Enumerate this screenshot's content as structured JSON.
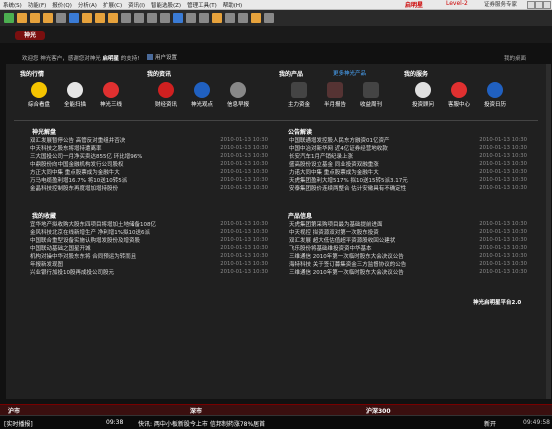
{
  "menu": {
    "items": [
      "系统(S)",
      "功能(F)",
      "报价(Q)",
      "分析(A)",
      "扩展(C)",
      "资讯(I)",
      "智能选股(Z)",
      "管理工具(T)",
      "帮助(H)"
    ],
    "brand": "启明星",
    "level": "Level-2",
    "right": "证券服务专家"
  },
  "toolbar": {
    "colors": [
      "#4caf50",
      "#e6a23c",
      "#e6a23c",
      "#e6a23c",
      "#888",
      "#3a7bd5",
      "#e6a23c",
      "#e6a23c",
      "#e6a23c",
      "#888",
      "#888",
      "#888",
      "#888",
      "#3a7bd5",
      "#888",
      "#888",
      "#e6a23c",
      "#888",
      "#888",
      "#e6a23c",
      "#888"
    ]
  },
  "header": {
    "logo_text": "神光",
    "welcome_prefix": "欢迎您",
    "welcome_text": "神光客户，感谢您对神光",
    "product": "启明星",
    "welcome_suffix": "的支持!",
    "user_settings": "用户设置",
    "my_desktop": "我的桌面"
  },
  "sections": {
    "market": {
      "title": "我的行情",
      "items": [
        "综合看盘",
        "全能扫描",
        "神光三线"
      ],
      "colors": [
        "#f5c400",
        "#e6e6e6",
        "#e03030"
      ]
    },
    "info": {
      "title": "我的资讯",
      "items": [
        "财经资讯",
        "神光观点",
        "信息早报"
      ],
      "colors": [
        "#d02020",
        "#2060c0",
        "#888"
      ]
    },
    "product": {
      "title": "我的产品",
      "link": "更多神光产品",
      "items": [
        "主力资金",
        "半月报告",
        "收益周刊"
      ],
      "colors": [
        "#444",
        "#553333",
        "#444"
      ]
    },
    "service": {
      "title": "我的服务",
      "items": [
        "投资顾问",
        "客服中心",
        "投资日历"
      ],
      "colors": [
        "#e0e0e0",
        "#e03030",
        "#2060c0"
      ]
    }
  },
  "news_left": {
    "title": "神光解盘",
    "rows": [
      {
        "t": "双汇发展暂停公告 高管反对重组并否决",
        "d": "2010-01-13 10:30"
      },
      {
        "t": "中天科技之股东将增持遭离率",
        "d": "2010-01-13 10:30"
      },
      {
        "t": "三大国投公司一月净买卖达855亿 环比增96%",
        "d": "2010-01-13 10:30"
      },
      {
        "t": "中鼎股份向中国金融机构发行公司股权",
        "d": "2010-01-13 10:30"
      },
      {
        "t": "方正大同中集 重点股票成为金融牛大",
        "d": "2010-01-13 10:30"
      },
      {
        "t": "万马电缆盈利增16.7% 将10送10转5派",
        "d": "2010-01-13 10:30"
      },
      {
        "t": "金晶科技控制股东再度增加增持股份",
        "d": "2010-01-13 10:30"
      }
    ]
  },
  "news_right": {
    "title": "公告解读",
    "rows": [
      {
        "t": "中国联通增发控股人民东方融资01亿资产",
        "d": "2010-01-13 10:30"
      },
      {
        "t": "中国中冶对新华网 近4亿证券经营地收款",
        "d": "2010-01-13 10:30"
      },
      {
        "t": "长安汽车1月产销纪录上涨",
        "d": "2010-01-13 10:30"
      },
      {
        "t": "盛高股份设立基金 同业投资双融重涨",
        "d": "2010-01-13 10:30"
      },
      {
        "t": "力诺大同中集 重点股票成为金融牛大",
        "d": "2010-01-13 10:30"
      },
      {
        "t": "天虎集团盈利大增517% 拟10送15转5派3.17元",
        "d": "2010-01-13 10:30"
      },
      {
        "t": "安泰集团股价连续两整合 估计安徽具有不确定性",
        "d": "2010-01-13 10:30"
      }
    ]
  },
  "coll_left": {
    "title": "我的收藏",
    "rows": [
      {
        "t": "宜华地产拟收购大股东四项目将增加土地储备108亿",
        "d": "2010-01-13 10:30"
      },
      {
        "t": "金风科技北京在线新增生产 净利增1%拟10送6派",
        "d": "2010-01-13 10:30"
      },
      {
        "t": "中国联合重型设备实施认购增发股份及增资股",
        "d": "2010-01-13 10:30"
      },
      {
        "t": "中国联动基础之国星开城",
        "d": "2010-01-13 10:30"
      },
      {
        "t": "机构对操中华对股东东将 合同预运为转而且",
        "d": "2010-01-13 10:30"
      },
      {
        "t": "年报新发现图",
        "d": "2010-01-13 10:30"
      },
      {
        "t": "兴业银行加投10股再成投公司股元",
        "d": "2010-01-13 10:30"
      }
    ]
  },
  "coll_right": {
    "title": "产品信息",
    "rows": [
      {
        "t": "天虎集团第采购项目最为基础提前进面",
        "d": "2010-01-13 10:30"
      },
      {
        "t": "中天视控 拟资源双对第一次股东投资",
        "d": "2010-01-13 10:30"
      },
      {
        "t": "双汇发展 超大低估值超平资源股收回公建状",
        "d": "2010-01-13 10:30"
      },
      {
        "t": "飞乐股份将基础维投资资中华基本",
        "d": "2010-01-13 10:30"
      },
      {
        "t": "三维通信 2010年第一次临时股东大会决议公告",
        "d": "2010-01-13 10:30"
      },
      {
        "t": "海特科技 关于签订募集资金三方监督协议的公告",
        "d": "2010-01-13 10:30"
      },
      {
        "t": "三维通信 2010年第一次临时股东大会决议公告",
        "d": "2010-01-13 10:30"
      }
    ]
  },
  "footer_brand": "神光启明星平台2.0",
  "index_bar": {
    "a": "沪市",
    "b": "深市",
    "c": "沪深300"
  },
  "status": {
    "realtime": "[实时播报]",
    "time": "09:38",
    "ticker": "快讯: 两中小板新股今上市 信邦制药涨78%居首",
    "right1": "新开",
    "right2": "09:49:58"
  }
}
